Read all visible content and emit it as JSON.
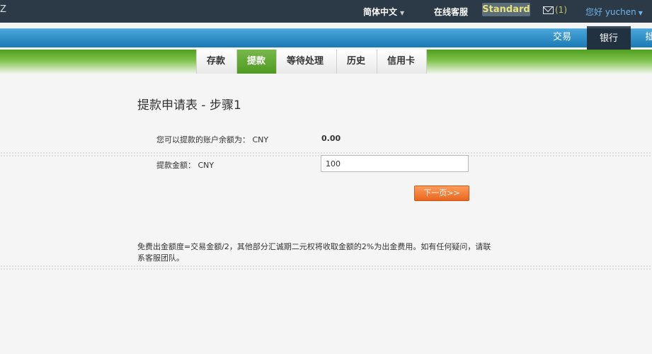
{
  "topbar": {
    "corner_glyph": "Z",
    "language": "简体中文",
    "support": "在线客服",
    "account_type": "Standard",
    "messages": "(1)",
    "greeting": "您好 yuchen"
  },
  "main_tabs": [
    {
      "label": "交易"
    },
    {
      "label": "银行"
    },
    {
      "label": "拙"
    }
  ],
  "sub_nav": [
    {
      "label": "存款"
    },
    {
      "label": "提款"
    },
    {
      "label": "等待处理"
    },
    {
      "label": "历史"
    },
    {
      "label": "信用卡"
    }
  ],
  "form": {
    "title": "提款申请表 - 步骤1",
    "balance_label": "您可以提款的账户余额为： CNY",
    "balance_value": "0.00",
    "amount_label": "提款金额： CNY",
    "amount_value": "100",
    "next_label": "下一页>>"
  },
  "notice": "免费出金额度=交易金额/2，其他部分汇诚期二元权将收取金额的2%为出金费用。如有任何疑问，请联系客服团队。",
  "colors": {
    "topbar": "#2c3947",
    "blue_bar": "#1b79b5",
    "green_bar": "#4f9e1f",
    "next_button": "#e8661e",
    "badge_text": "#e9e27a"
  },
  "icons": {
    "mail": "envelope-icon",
    "dropdown": "caret-down-icon"
  }
}
